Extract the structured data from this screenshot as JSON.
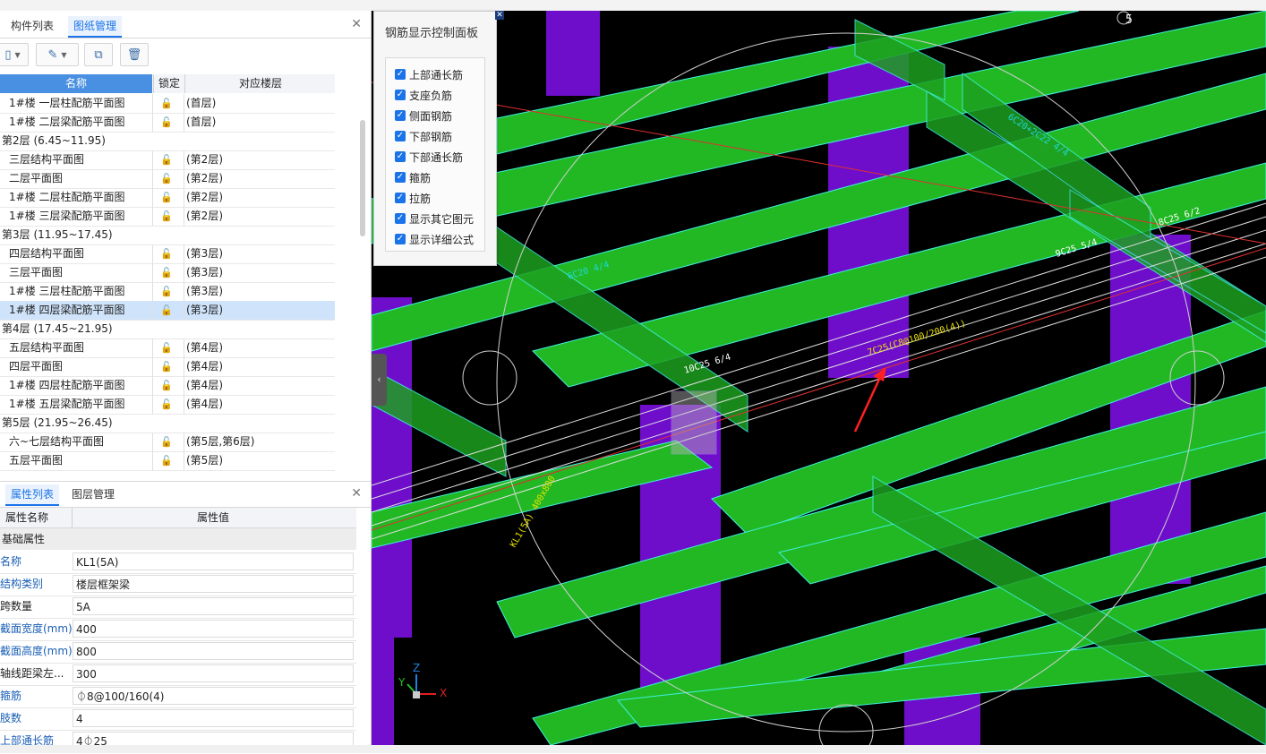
{
  "drawing_panel": {
    "tabs": [
      "构件列表",
      "图纸管理"
    ],
    "toolbar_icons": [
      "add-drawing-icon",
      "edit-drawing-icon",
      "copy-drawing-icon",
      "delete-icon"
    ],
    "columns": {
      "name": "名称",
      "lock": "锁定",
      "floor": "对应楼层"
    },
    "rows": [
      {
        "kind": "item",
        "name": "1#楼  一层柱配筋平面图",
        "floor": "(首层)"
      },
      {
        "kind": "item",
        "name": "1#楼  二层梁配筋平面图",
        "floor": "(首层)"
      },
      {
        "kind": "group",
        "name": "第2层 (6.45~11.95)"
      },
      {
        "kind": "item",
        "name": "三层结构平面图",
        "floor": "(第2层)"
      },
      {
        "kind": "item",
        "name": "二层平面图",
        "floor": "(第2层)"
      },
      {
        "kind": "item",
        "name": "1#楼  二层柱配筋平面图",
        "floor": "(第2层)"
      },
      {
        "kind": "item",
        "name": "1#楼  三层梁配筋平面图",
        "floor": "(第2层)"
      },
      {
        "kind": "group",
        "name": "第3层 (11.95~17.45)"
      },
      {
        "kind": "item",
        "name": "四层结构平面图",
        "floor": "(第3层)"
      },
      {
        "kind": "item",
        "name": "三层平面图",
        "floor": "(第3层)"
      },
      {
        "kind": "item",
        "name": "1#楼  三层柱配筋平面图",
        "floor": "(第3层)"
      },
      {
        "kind": "item",
        "name": "1#楼  四层梁配筋平面图",
        "floor": "(第3层)",
        "selected": true
      },
      {
        "kind": "group",
        "name": "第4层 (17.45~21.95)"
      },
      {
        "kind": "item",
        "name": "五层结构平面图",
        "floor": "(第4层)"
      },
      {
        "kind": "item",
        "name": "四层平面图",
        "floor": "(第4层)"
      },
      {
        "kind": "item",
        "name": "1#楼  四层柱配筋平面图",
        "floor": "(第4层)"
      },
      {
        "kind": "item",
        "name": "1#楼  五层梁配筋平面图",
        "floor": "(第4层)"
      },
      {
        "kind": "group",
        "name": "第5层 (21.95~26.45)"
      },
      {
        "kind": "item",
        "name": "六~七层结构平面图",
        "floor": "(第5层,第6层)"
      },
      {
        "kind": "item",
        "name": "五层平面图",
        "floor": "(第5层)"
      }
    ]
  },
  "property_panel": {
    "tabs": [
      "属性列表",
      "图层管理"
    ],
    "columns": {
      "name": "属性名称",
      "value": "属性值"
    },
    "group": "基础属性",
    "rows": [
      {
        "key": "名称",
        "value": "KL1(5A)"
      },
      {
        "key": "结构类别",
        "value": "楼层框架梁"
      },
      {
        "key": "跨数量",
        "value": "5A"
      },
      {
        "key": "截面宽度(mm)",
        "value": "400"
      },
      {
        "key": "截面高度(mm)",
        "value": "800"
      },
      {
        "key": "轴线距梁左...",
        "value": "300"
      },
      {
        "key": "箍筋",
        "value": "⏀8@100/160(4)"
      },
      {
        "key": "肢数",
        "value": "4"
      },
      {
        "key": "上部通长筋",
        "value": "4⏀25"
      }
    ]
  },
  "rebar_control_panel": {
    "title": "钢筋显示控制面板",
    "options": [
      {
        "label": "上部通长筋",
        "checked": true
      },
      {
        "label": "支座负筋",
        "checked": true
      },
      {
        "label": "侧面钢筋",
        "checked": true
      },
      {
        "label": "下部钢筋",
        "checked": true
      },
      {
        "label": "下部通长筋",
        "checked": true
      },
      {
        "label": "箍筋",
        "checked": true
      },
      {
        "label": "拉筋",
        "checked": true
      },
      {
        "label": "显示其它图元",
        "checked": true
      },
      {
        "label": "显示详细公式",
        "checked": true
      }
    ]
  },
  "viewport": {
    "annotations": [
      "10C25 6/4",
      "7C25(C8@100/200(4))",
      "9C25 5/4",
      "8C25 6/2",
      "KL1(5A) 400x800",
      "6C20+2C22 4/4",
      "6C20 4/4",
      "5"
    ],
    "axis_labels": {
      "x": "X",
      "y": "Y",
      "z": "Z"
    },
    "colors": {
      "beam": "#22b824",
      "column": "#7a10e0",
      "annotation": "#e8e000",
      "background": "#000000"
    }
  }
}
